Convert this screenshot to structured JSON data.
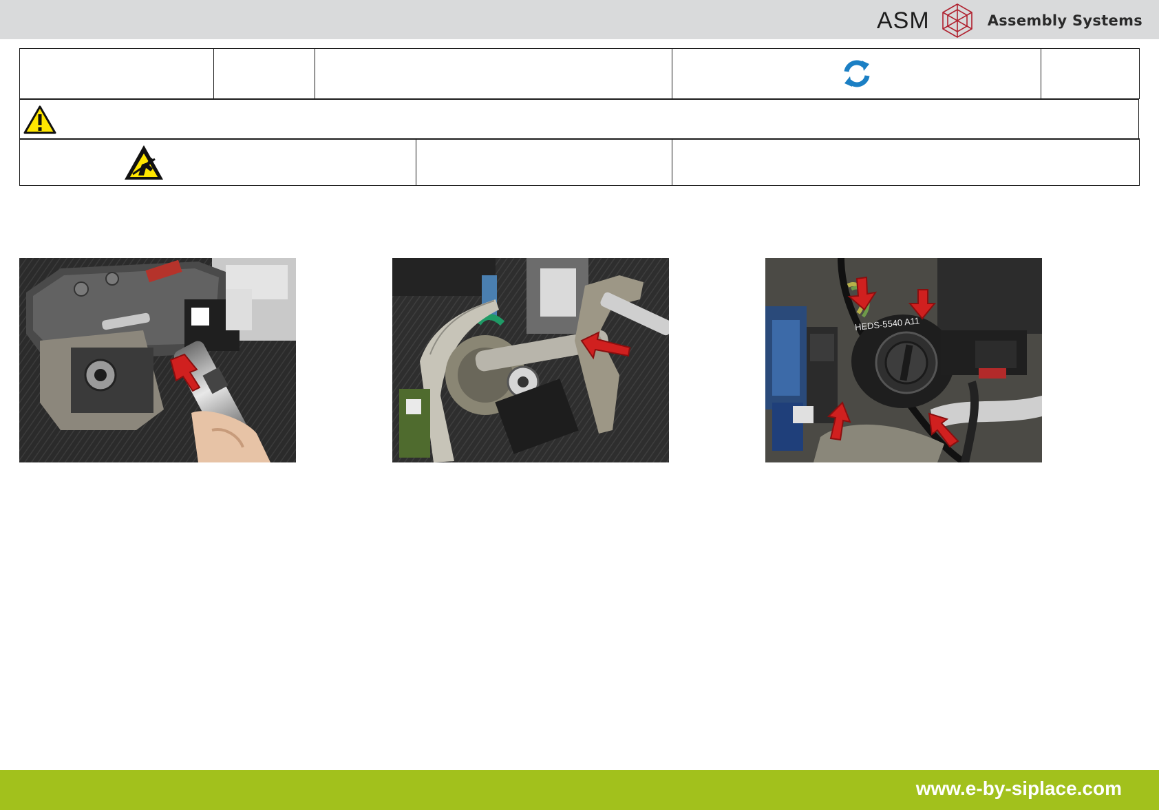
{
  "header": {
    "brand_short": "ASM",
    "brand_full": "Assembly Systems",
    "logo_icon": "asm-polyhedron-logo",
    "bar_color": "#d9dadb"
  },
  "info_table": {
    "row1": {
      "cells": [
        "",
        "",
        "",
        "",
        ""
      ],
      "refresh_icon": "refresh-icon",
      "refresh_color": "#1b7fc4"
    },
    "row2": {
      "warning_icon": "warning-icon"
    },
    "row3": {
      "esd_icon": "esd-warning-icon",
      "cells": [
        "",
        ""
      ]
    }
  },
  "photos": [
    {
      "icon": "photo-motor-removal",
      "arrow_count": 1
    },
    {
      "icon": "photo-belt-screwdriver",
      "arrow_count": 1
    },
    {
      "icon": "photo-encoder-connectors",
      "label": "HEDS-5540 A11",
      "arrow_count": 4
    }
  ],
  "footer": {
    "url": "www.e-by-siplace.com",
    "bar_color": "#a2c11c"
  }
}
